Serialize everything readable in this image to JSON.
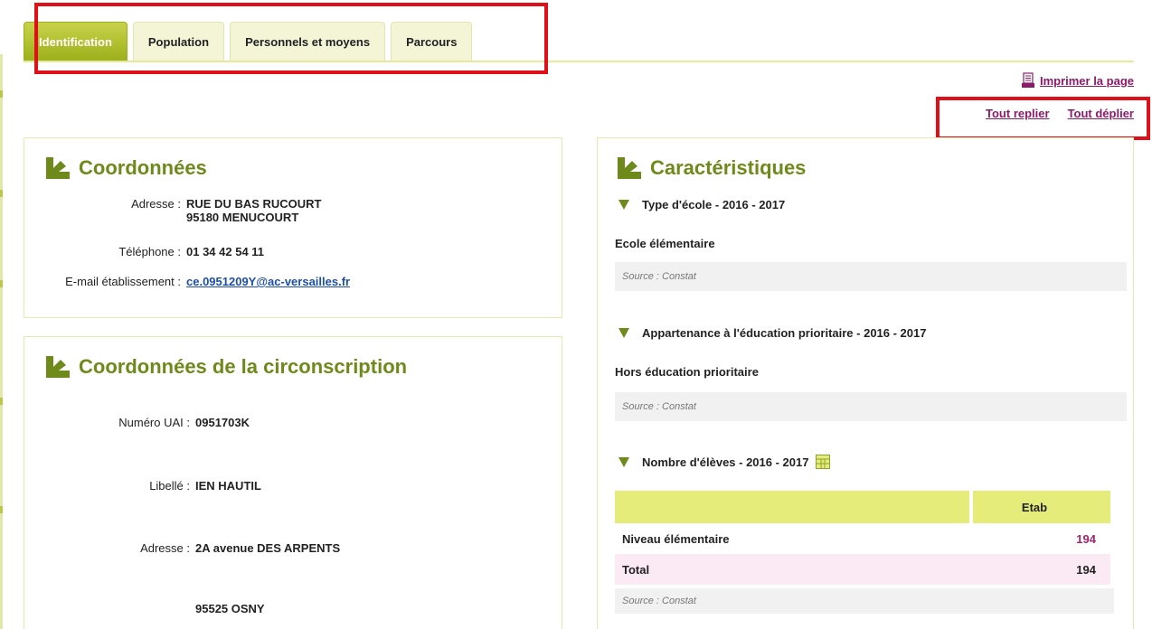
{
  "tabs": [
    {
      "label": "Identification",
      "active": true
    },
    {
      "label": "Population",
      "active": false
    },
    {
      "label": "Personnels et moyens",
      "active": false
    },
    {
      "label": "Parcours",
      "active": false
    }
  ],
  "actions": {
    "print_label": "Imprimer la page",
    "collapse_all": "Tout replier",
    "expand_all": "Tout déplier"
  },
  "coordonnees": {
    "title": "Coordonnées",
    "address_label": "Adresse :",
    "address_line1": "RUE DU BAS RUCOURT",
    "address_line2": "95180 MENUCOURT",
    "phone_label": "Téléphone :",
    "phone": "01 34 42 54 11",
    "email_label": "E-mail établissement :",
    "email": "ce.0951209Y@ac-versailles.fr"
  },
  "circonscription": {
    "title": "Coordonnées de la circonscription",
    "uai_label": "Numéro UAI :",
    "uai": "0951703K",
    "libelle_label": "Libellé :",
    "libelle": "IEN HAUTIL",
    "address_label": "Adresse :",
    "address_line1": "2A avenue DES ARPENTS",
    "address_line2": "95525 OSNY"
  },
  "caracteristiques": {
    "title": "Caractéristiques",
    "type": {
      "heading": "Type d'école - 2016 - 2017",
      "value": "Ecole élémentaire",
      "source": "Source : Constat"
    },
    "prioritaire": {
      "heading": "Appartenance à l'éducation prioritaire - 2016 - 2017",
      "value": "Hors éducation prioritaire",
      "source": "Source : Constat"
    },
    "eleves": {
      "heading": "Nombre d'élèves - 2016 - 2017",
      "col_header": "Etab",
      "rows": [
        {
          "label": "Niveau élémentaire",
          "value": "194"
        },
        {
          "label": "Total",
          "value": "194"
        }
      ],
      "source": "Source : Constat"
    }
  },
  "colors": {
    "accent": "#6e8a1a",
    "tab_active": "#9bb01a",
    "link": "#8b1a6b",
    "highlight_box": "#e0101a"
  }
}
